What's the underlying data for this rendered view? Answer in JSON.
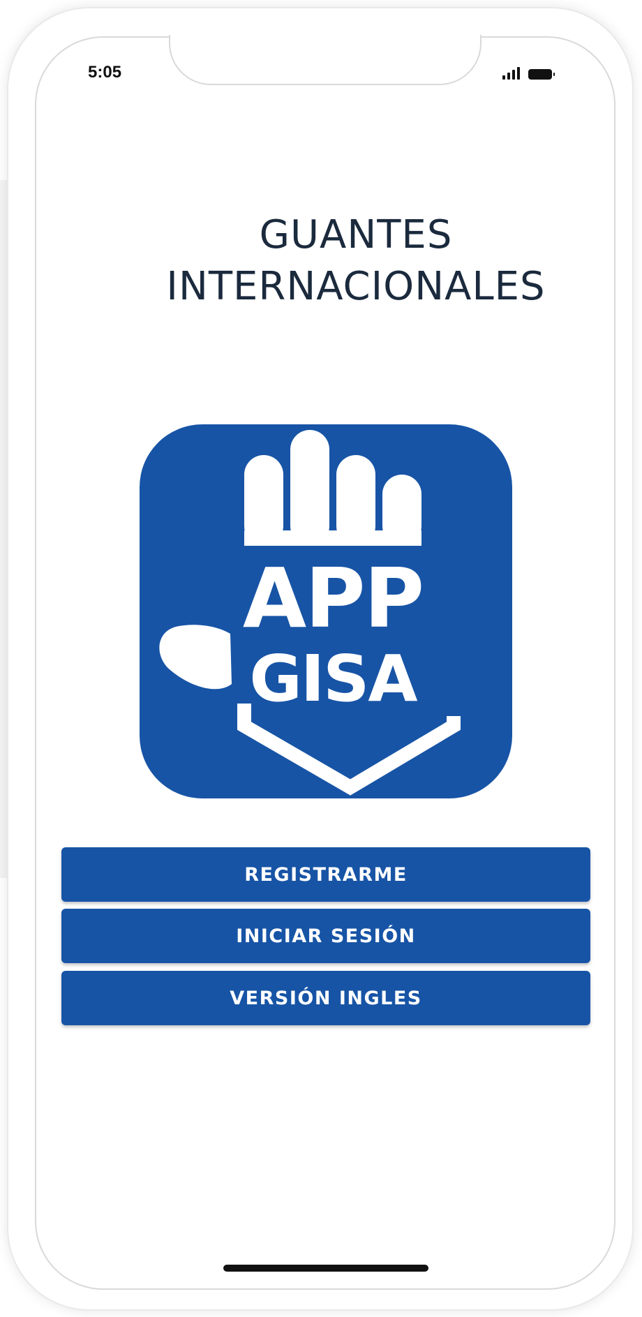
{
  "status_bar": {
    "time": "5:05",
    "icons": [
      "signal-icon",
      "battery-icon"
    ]
  },
  "title": {
    "line1": "GUANTES",
    "line2": "INTERNACIONALES"
  },
  "logo": {
    "line1": "APP",
    "line2": "GISA",
    "icon": "hand-logo-icon"
  },
  "buttons": {
    "register": "REGISTRARME",
    "login": "INICIAR SESIÓN",
    "english": "VERSIÓN INGLES"
  },
  "colors": {
    "brand_blue": "#1754a6",
    "title_text": "#1b2a3d",
    "button_text": "#ffffff"
  }
}
